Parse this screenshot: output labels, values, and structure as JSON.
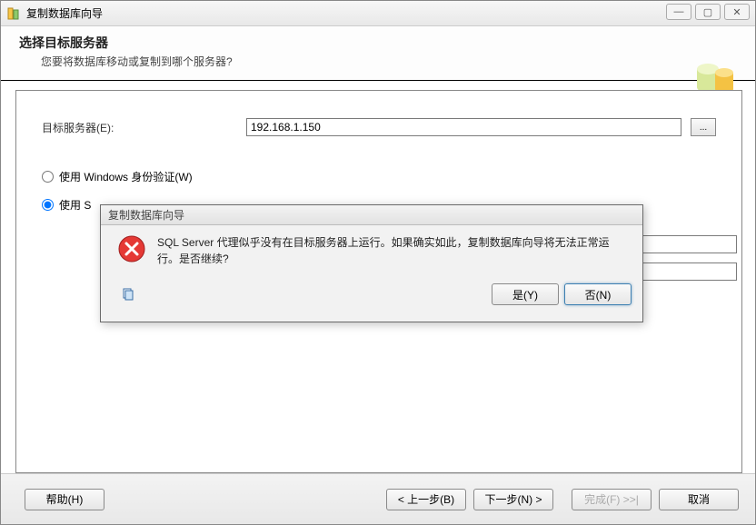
{
  "titlebar": {
    "title": "复制数据库向导",
    "minimize": "—",
    "maximize": "▢",
    "close": "✕"
  },
  "header": {
    "title": "选择目标服务器",
    "subtitle": "您要将数据库移动或复制到哪个服务器?"
  },
  "form": {
    "target_server_label": "目标服务器(E):",
    "target_server_value": "192.168.1.150",
    "browse_label": "...",
    "auth_windows_label": "使用 Windows 身份验证(W)",
    "auth_sql_label_partial": "使用 S"
  },
  "footer": {
    "help": "帮助(H)",
    "back": "< 上一步(B)",
    "next": "下一步(N) >",
    "finish": "完成(F) >>|",
    "cancel": "取消"
  },
  "modal": {
    "title": "复制数据库向导",
    "message": "SQL Server 代理似乎没有在目标服务器上运行。如果确实如此，复制数据库向导将无法正常运行。是否继续?",
    "yes": "是(Y)",
    "no": "否(N)"
  }
}
